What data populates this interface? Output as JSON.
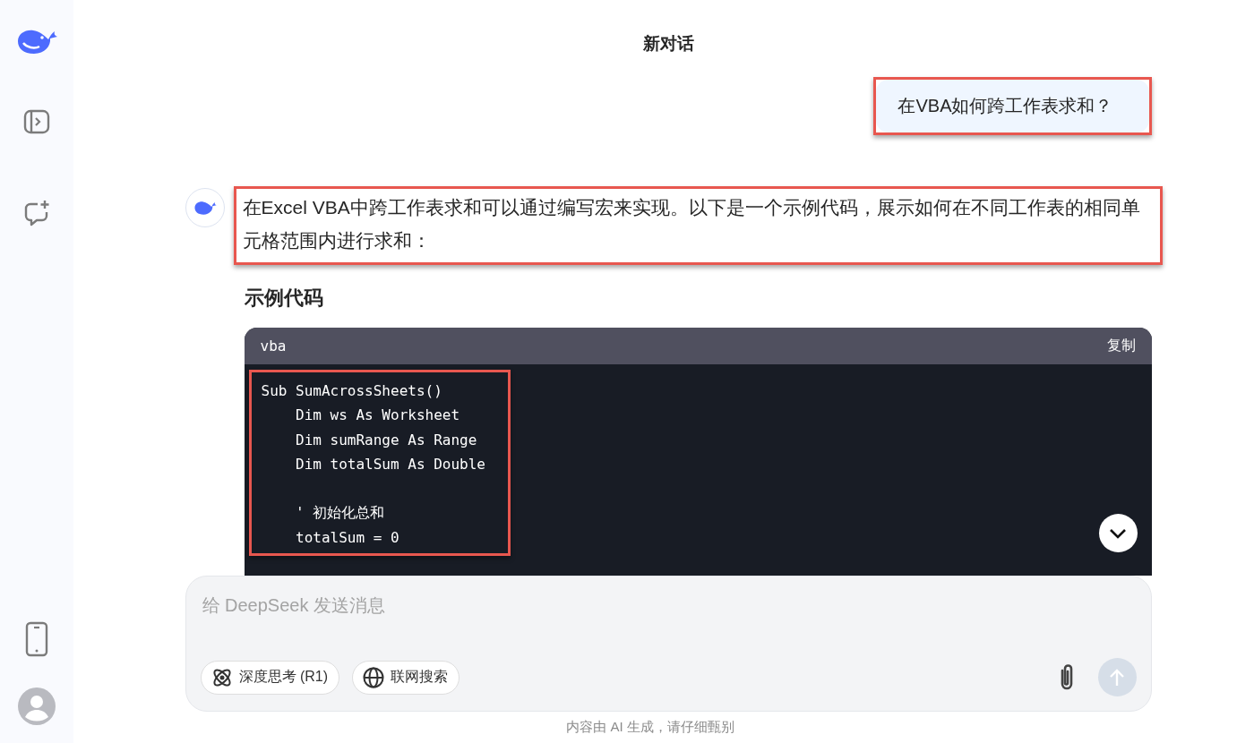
{
  "header": {
    "title": "新对话"
  },
  "user_message": {
    "text": "在VBA如何跨工作表求和？",
    "highlighted": true
  },
  "reply": {
    "paragraph": "在Excel VBA中跨工作表求和可以通过编写宏来实现。以下是一个示例代码，展示如何在不同工作表的相同单元格范围内进行求和：",
    "paragraph_highlighted": true,
    "heading": "示例代码",
    "code": {
      "language": "vba",
      "copy_label": "复制",
      "highlighted": true,
      "blocks": [
        {
          "lines": [
            "Sub SumAcrossSheets()",
            "    Dim ws As Worksheet",
            "    Dim sumRange As Range",
            "    Dim totalSum As Double"
          ]
        },
        {
          "lines": [
            "    ' 初始化总和",
            "    totalSum = 0"
          ]
        }
      ]
    }
  },
  "composer": {
    "placeholder": "给 DeepSeek 发送消息",
    "send_disabled": true,
    "toggles": [
      {
        "kind": "deep-think",
        "label": "深度思考 (R1)",
        "selected": false
      },
      {
        "kind": "web-search",
        "label": "联网搜索",
        "selected": false
      }
    ]
  },
  "disclaimer": "内容由 AI 生成，请仔细甄别"
}
